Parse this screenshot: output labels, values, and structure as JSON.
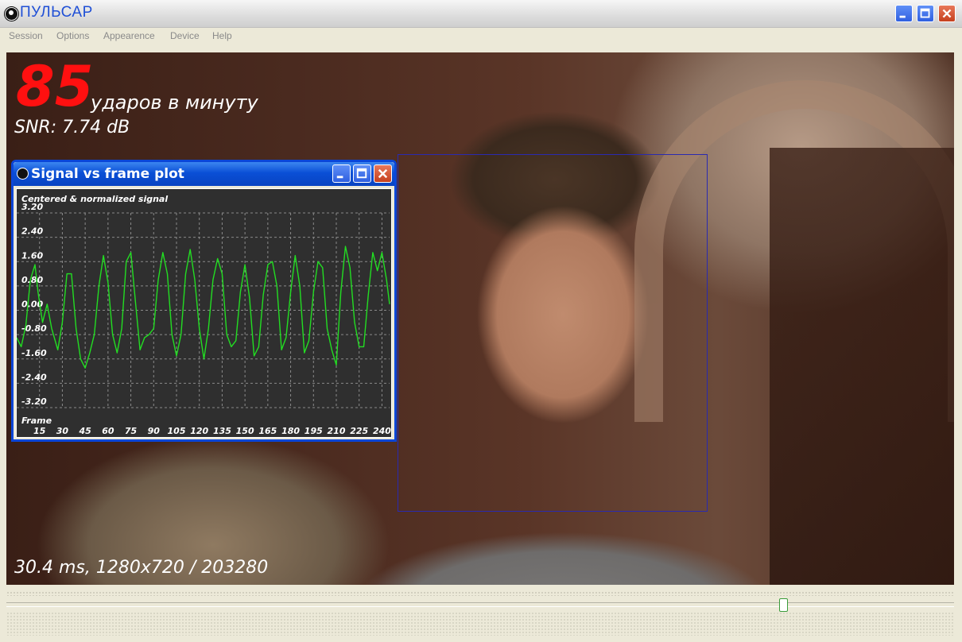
{
  "window": {
    "title": "ПУЛЬСАР"
  },
  "menu": [
    "Session",
    "Options",
    "Appearence",
    "Device",
    "Help"
  ],
  "overlay": {
    "bpm": "85",
    "bpm_unit": "ударов в минуту",
    "snr": "SNR: 7.74 dB",
    "status": "30.4 ms, 1280x720 / 203280"
  },
  "plot_window": {
    "title": "Signal vs frame plot"
  },
  "chart_data": {
    "type": "line",
    "title": "Centered & normalized signal",
    "xlabel": "Frame",
    "ylabel": "",
    "xlim": [
      0,
      245
    ],
    "ylim": [
      -3.2,
      3.2
    ],
    "x_ticks": [
      15,
      30,
      45,
      60,
      75,
      90,
      105,
      120,
      135,
      150,
      165,
      180,
      195,
      210,
      225,
      240
    ],
    "y_ticks": [
      3.2,
      2.4,
      1.6,
      0.8,
      0.0,
      -0.8,
      -1.6,
      -2.4,
      -3.2
    ],
    "y_tick_labels": [
      "3.20",
      "2.40",
      "1.60",
      "0.80",
      "0.00",
      "-0.80",
      "-1.60",
      "-2.40",
      "-3.20"
    ],
    "grid": true,
    "line_color": "#22dd22",
    "series": [
      {
        "x": [
          0,
          3,
          6,
          9,
          12,
          14,
          17,
          20,
          23,
          27,
          30,
          33,
          36,
          39,
          42,
          45,
          48,
          51,
          54,
          57,
          60,
          63,
          66,
          69,
          72,
          75,
          78,
          81,
          84,
          87,
          90,
          93,
          96,
          99,
          102,
          105,
          108,
          111,
          114,
          117,
          120,
          123,
          126,
          129,
          132,
          135,
          138,
          141,
          144,
          147,
          150,
          153,
          156,
          159,
          162,
          165,
          168,
          171,
          174,
          177,
          180,
          183,
          186,
          189,
          192,
          195,
          198,
          201,
          204,
          207,
          210,
          213,
          216,
          219,
          222,
          225,
          228,
          231,
          234,
          237,
          240,
          243,
          245
        ],
        "y": [
          -0.9,
          -1.2,
          -0.5,
          1.0,
          1.5,
          0.6,
          -0.4,
          0.2,
          -0.6,
          -1.3,
          -0.4,
          1.2,
          1.2,
          -0.6,
          -1.6,
          -1.9,
          -1.4,
          -0.8,
          0.8,
          1.8,
          0.9,
          -0.8,
          -1.4,
          -0.6,
          1.6,
          1.9,
          0.3,
          -1.3,
          -0.9,
          -0.8,
          -0.6,
          1.0,
          1.9,
          1.2,
          -0.8,
          -1.5,
          -0.8,
          1.2,
          2.0,
          1.0,
          -0.6,
          -1.6,
          -0.6,
          1.0,
          1.7,
          1.2,
          -0.8,
          -1.2,
          -1.0,
          0.6,
          1.5,
          0.4,
          -1.5,
          -1.2,
          0.5,
          1.5,
          1.6,
          0.8,
          -1.3,
          -0.9,
          0.6,
          1.8,
          0.8,
          -1.4,
          -1.0,
          0.6,
          1.6,
          1.4,
          -0.6,
          -1.3,
          -1.8,
          0.6,
          2.1,
          1.4,
          -0.4,
          -1.2,
          -1.2,
          0.5,
          1.9,
          1.3,
          1.9,
          1.0,
          0.2
        ]
      }
    ]
  },
  "colors": {
    "bpm": "#ff1010",
    "face_box": "#2a2ab0",
    "plot_background": "#2f2f2f",
    "signal": "#22dd22",
    "plot_titlebar": "#0a4fd6"
  },
  "playback": {
    "position_fraction": 0.82
  }
}
